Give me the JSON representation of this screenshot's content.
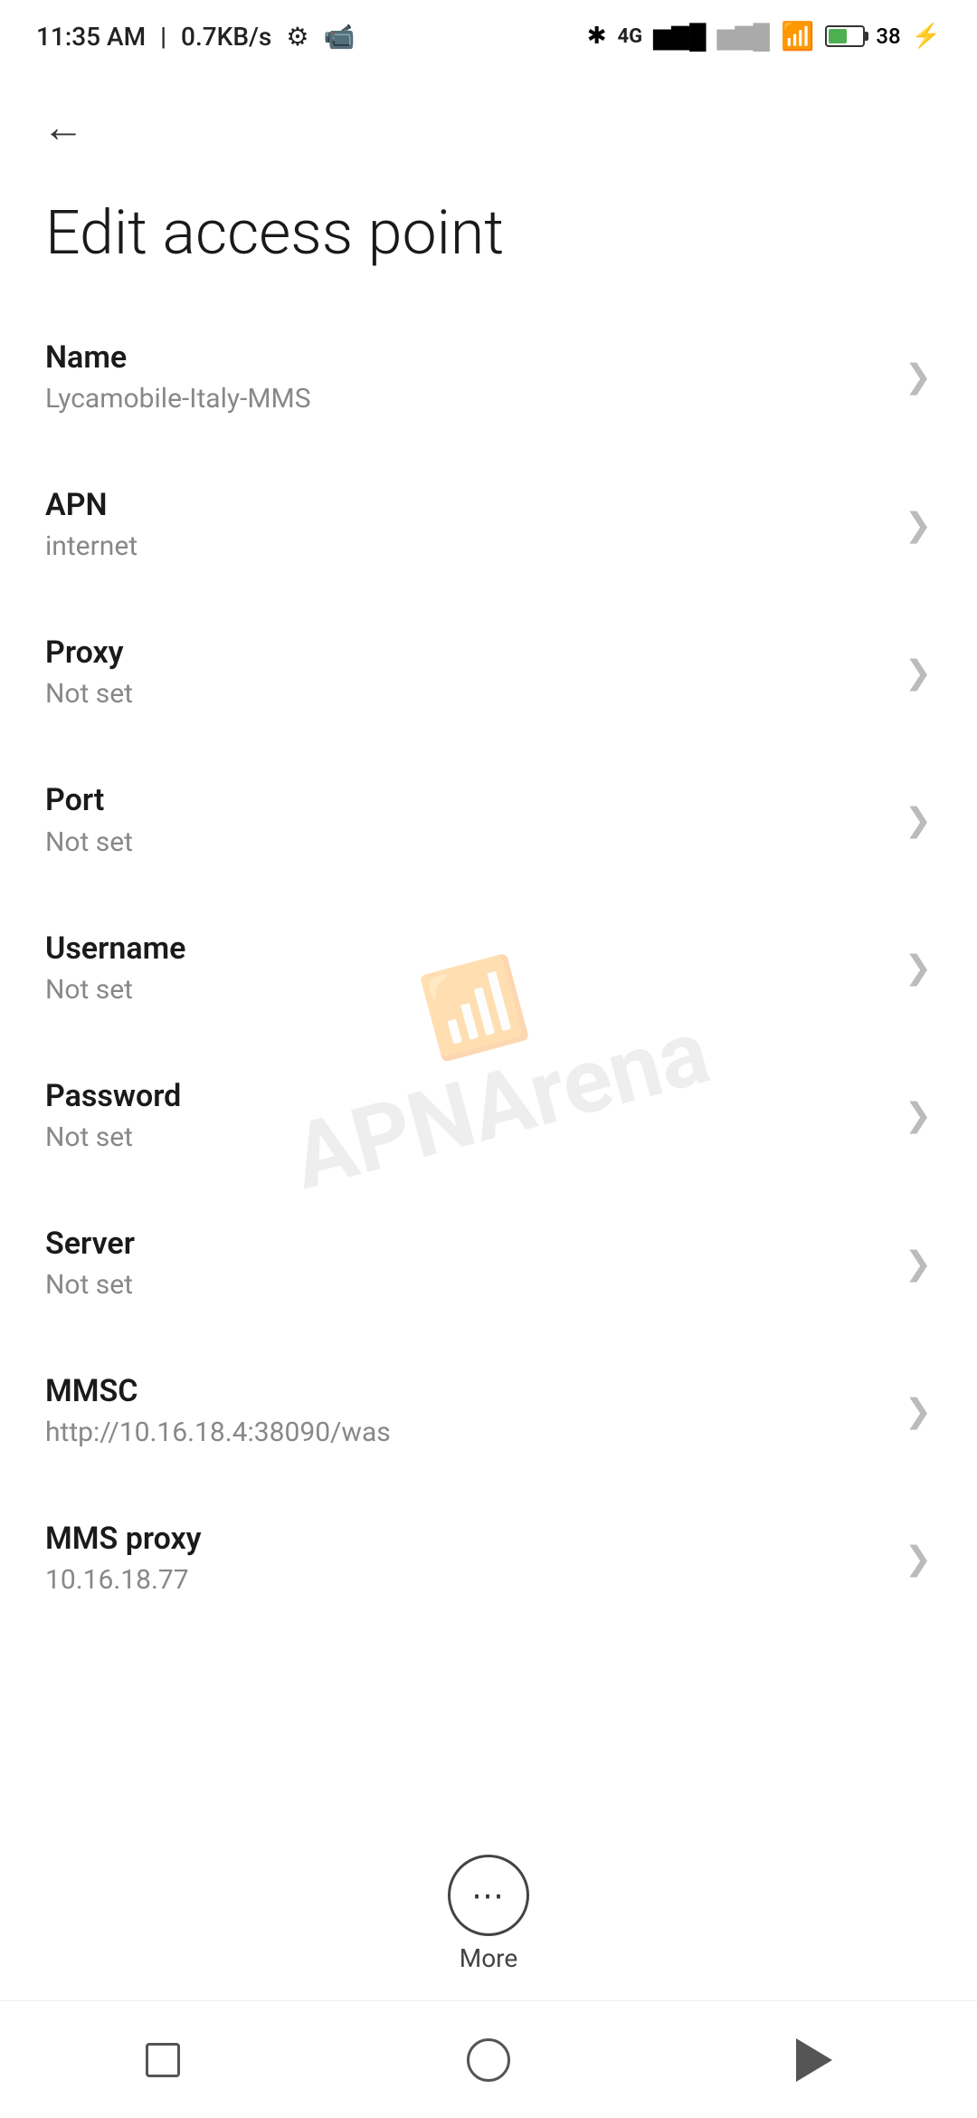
{
  "status_bar": {
    "time": "11:35 AM",
    "speed": "0.7KB/s"
  },
  "header": {
    "back_label": "←",
    "title": "Edit access point"
  },
  "settings": {
    "items": [
      {
        "label": "Name",
        "value": "Lycamobile-Italy-MMS"
      },
      {
        "label": "APN",
        "value": "internet"
      },
      {
        "label": "Proxy",
        "value": "Not set"
      },
      {
        "label": "Port",
        "value": "Not set"
      },
      {
        "label": "Username",
        "value": "Not set"
      },
      {
        "label": "Password",
        "value": "Not set"
      },
      {
        "label": "Server",
        "value": "Not set"
      },
      {
        "label": "MMSC",
        "value": "http://10.16.18.4:38090/was"
      },
      {
        "label": "MMS proxy",
        "value": "10.16.18.77"
      }
    ]
  },
  "more_button": {
    "label": "More"
  },
  "watermark": {
    "text": "APNArena"
  }
}
